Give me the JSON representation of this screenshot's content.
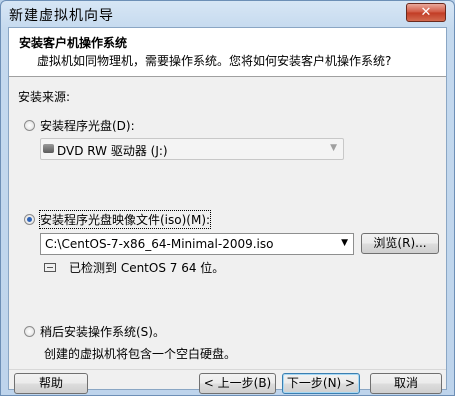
{
  "window": {
    "title": "新建虚拟机向导",
    "close_label": "✕"
  },
  "header": {
    "title": "安装客户机操作系统",
    "subtitle": "虚拟机如同物理机，需要操作系统。您将如何安装客户机操作系统?"
  },
  "source": {
    "label": "安装来源:",
    "option_disc": "安装程序光盘(D):",
    "disc_drive": "DVD RW 驱动器 (J:)",
    "option_iso": "安装程序光盘映像文件(iso)(M):",
    "iso_path": "C:\\CentOS-7-x86_64-Minimal-2009.iso",
    "browse_label": "浏览(R)...",
    "detected_text": "已检测到 CentOS 7 64 位。",
    "option_later": "稍后安装操作系统(S)。",
    "later_desc": "创建的虚拟机将包含一个空白硬盘。",
    "selected": "iso"
  },
  "buttons": {
    "help": "帮助",
    "back": "< 上一步(B)",
    "next": "下一步(N) >",
    "cancel": "取消"
  },
  "icons": {
    "drive": "dvd-drive-icon",
    "detect": "info-icon",
    "dropdown": "chevron-down-icon",
    "close": "close-icon"
  }
}
